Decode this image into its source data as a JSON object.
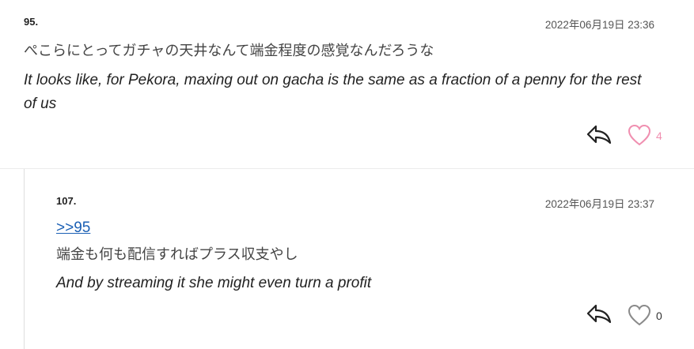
{
  "comments": [
    {
      "number": "95.",
      "timestamp": "2022年06月19日 23:36",
      "original": "ぺこらにとってガチャの天井なんて端金程度の感覚なんだろうな",
      "translation": "It looks like, for Pekora, maxing out on gacha is the same as a fraction of a penny for the rest of us",
      "likes": "4",
      "like_color": "#f08fb0"
    },
    {
      "number": "107.",
      "timestamp": "2022年06月19日 23:37",
      "reply_to": ">>95",
      "original": "端金も何も配信すればプラス収支やし",
      "translation": "And by streaming it she might even turn a profit",
      "likes": "0",
      "like_color": "#8a8a8a"
    }
  ]
}
